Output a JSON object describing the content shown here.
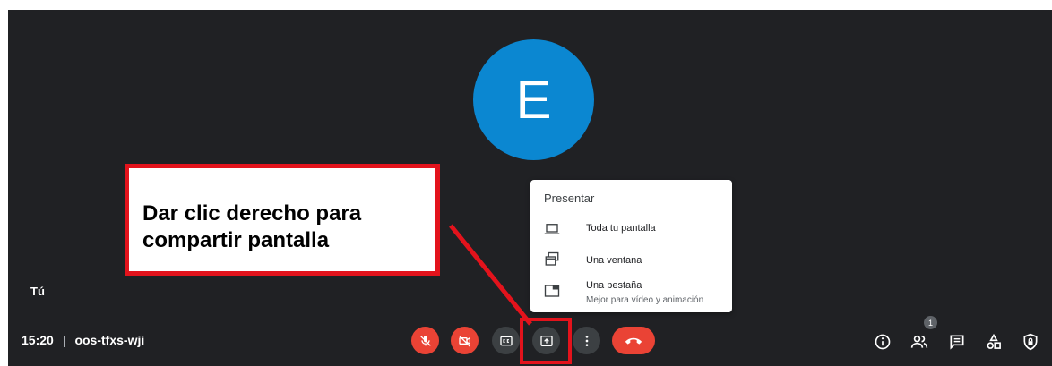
{
  "participant": {
    "initial": "E",
    "self_label": "Tú"
  },
  "meeting": {
    "time": "15:20",
    "separator": "|",
    "code": "oos-tfxs-wji"
  },
  "annotation": {
    "text": "Dar clic derecho para compartir pantalla"
  },
  "present_menu": {
    "title": "Presentar",
    "items": [
      {
        "label": "Toda tu pantalla",
        "icon": "laptop-icon"
      },
      {
        "label": "Una ventana",
        "icon": "window-icon"
      },
      {
        "label": "Una pestaña",
        "sublabel": "Mejor para vídeo y animación",
        "icon": "tab-icon"
      }
    ]
  },
  "controls": {
    "mic": "mic-off-icon",
    "camera": "camera-off-icon",
    "captions": "closed-captions-icon",
    "present": "present-screen-icon",
    "more": "more-vert-icon",
    "hangup": "hang-up-icon"
  },
  "right_toolbar": {
    "people_count": "1"
  },
  "colors": {
    "background": "#202124",
    "avatar": "#0b87d1",
    "danger": "#ea4335",
    "control_gray": "#3c4043",
    "annotation_red": "#e3131c"
  }
}
